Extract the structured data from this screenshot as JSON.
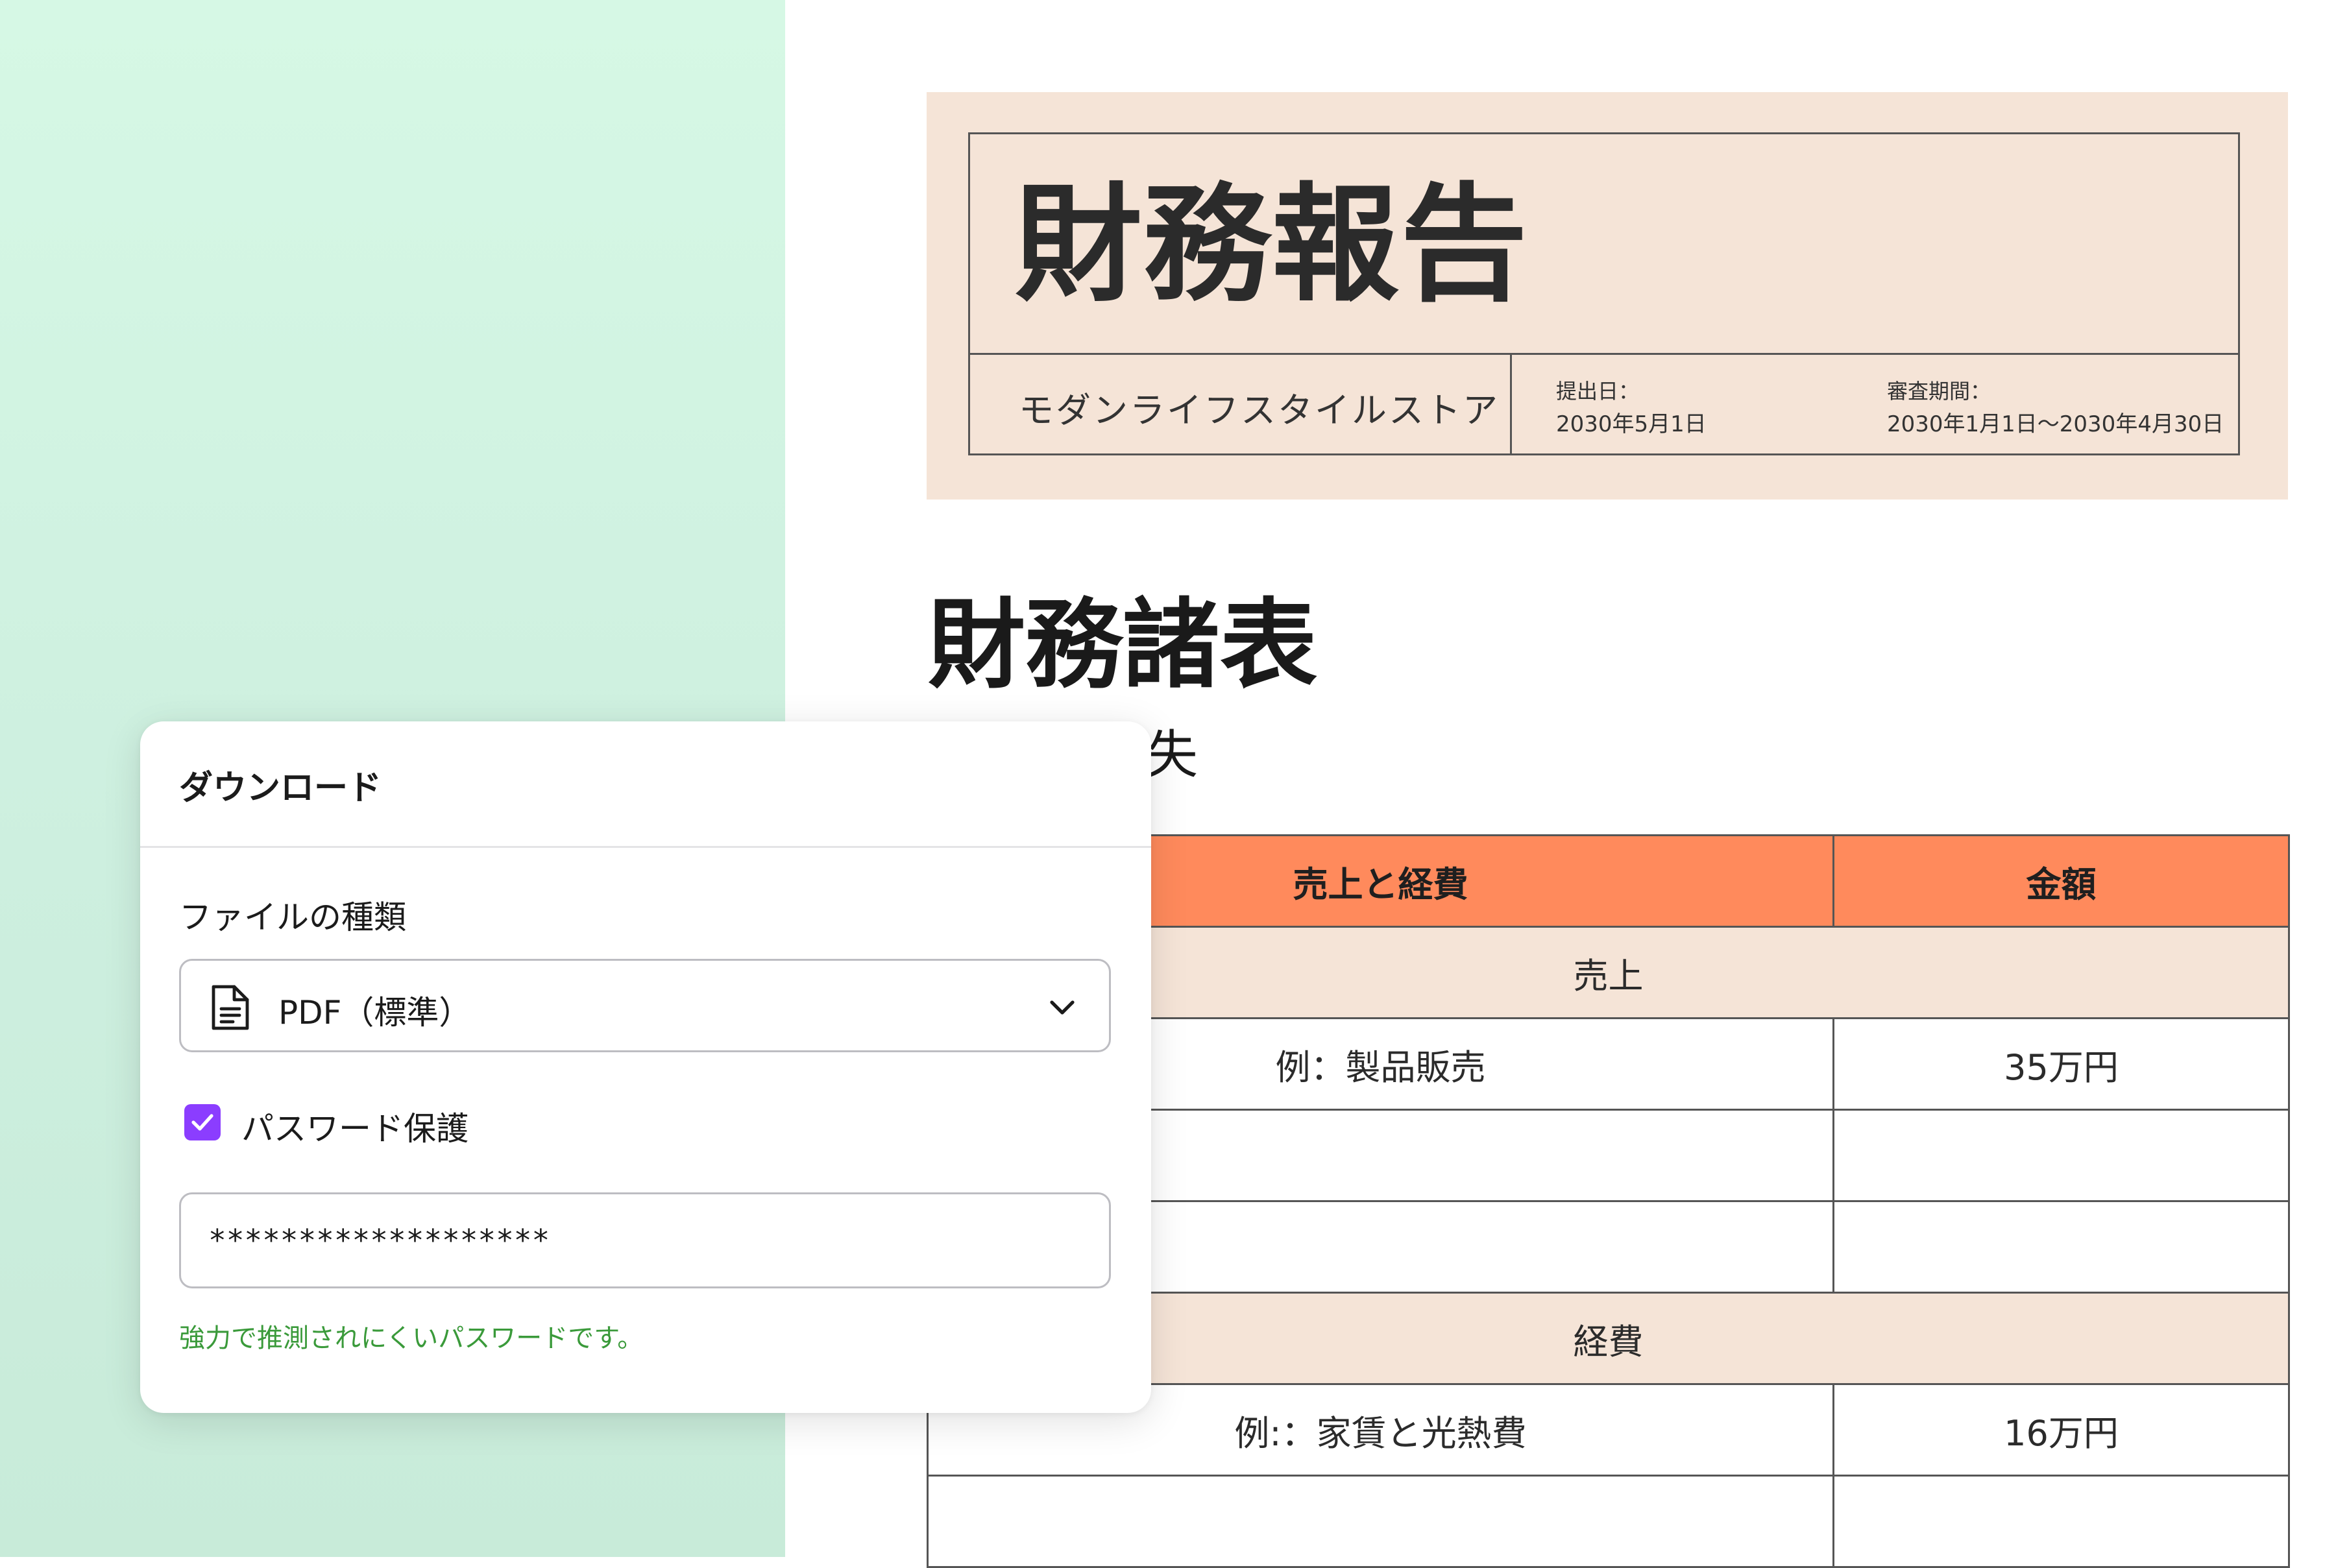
{
  "report": {
    "title": "財務報告",
    "store_name": "モダンライフスタイルストア",
    "submission_label": "提出日：",
    "submission_date": "2030年5月1日",
    "period_label": "審査期間：",
    "period_value": "2030年1月1日〜2030年4月30日"
  },
  "section": {
    "title": "財務諸表",
    "subtitle_visible": "失"
  },
  "table": {
    "headers": [
      "売上と経費",
      "金額"
    ],
    "revenue_heading": "売上",
    "revenue_rows": [
      {
        "item": "例：製品販売",
        "amount": "35万円"
      },
      {
        "item": "",
        "amount": ""
      },
      {
        "item": "",
        "amount": ""
      }
    ],
    "expense_heading": "経費",
    "expense_rows": [
      {
        "item": "例:：家賃と光熱費",
        "amount": "16万円"
      },
      {
        "item": "",
        "amount": ""
      }
    ]
  },
  "dialog": {
    "title": "ダウンロード",
    "file_type_label": "ファイルの種類",
    "file_type_value": "PDF（標準）",
    "file_type_icon": "document-icon",
    "dropdown_icon": "chevron-down-icon",
    "password_protect_label": "パスワード保護",
    "password_protect_checked": true,
    "password_value": "*******************",
    "strength_message": "強力で推測されにくいパスワードです。"
  },
  "colors": {
    "mint_background": "#d2f4e2",
    "banner_background": "#f5e4d7",
    "table_header": "#ff8a5c",
    "checkbox_accent": "#8b3dff",
    "strength_text": "#3a9a3a"
  }
}
